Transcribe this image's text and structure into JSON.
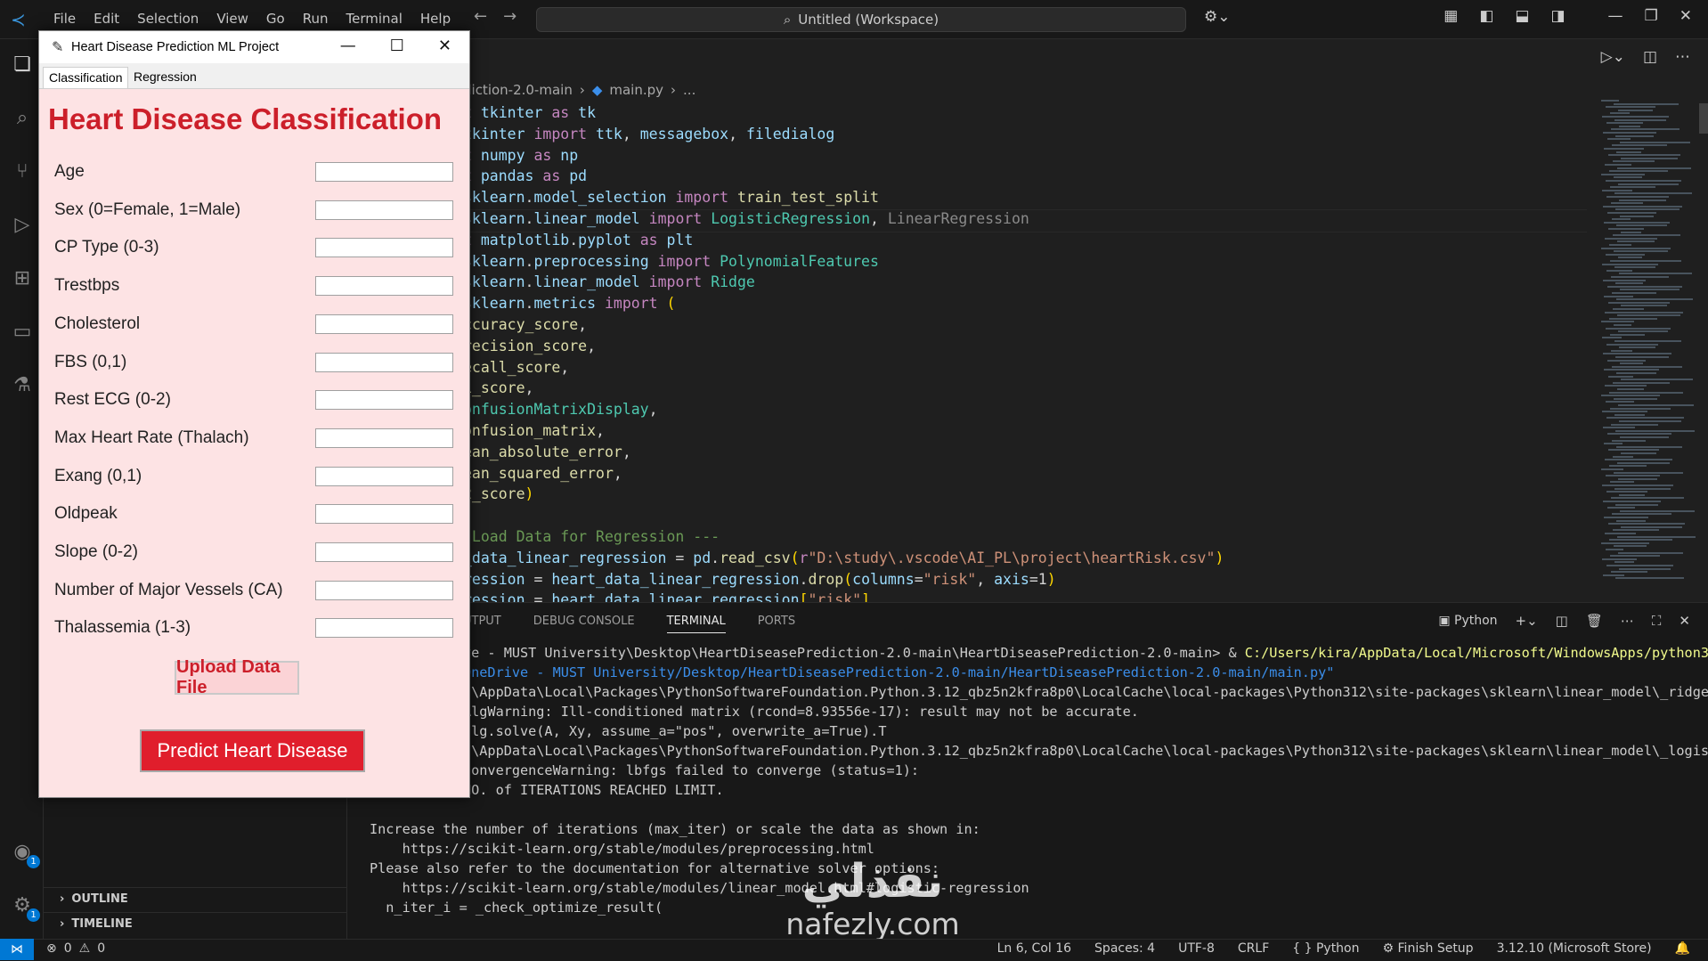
{
  "vscode": {
    "menu": [
      "File",
      "Edit",
      "Selection",
      "View",
      "Go",
      "Run",
      "Terminal",
      "Help"
    ],
    "search_text": "Untitled (Workspace)",
    "breadcrumb": {
      "folder": "diction-2.0-main",
      "file": "main.py",
      "more": "..."
    },
    "code_lines": [
      [
        [
          "kw",
          "t "
        ],
        [
          "id",
          "tkinter"
        ],
        [
          "kw",
          " as "
        ],
        [
          "id",
          "tk"
        ]
      ],
      [
        [
          "id",
          "tkinter"
        ],
        [
          "kw",
          " import "
        ],
        [
          "id",
          "ttk"
        ],
        [
          "pn",
          ", "
        ],
        [
          "id",
          "messagebox"
        ],
        [
          "pn",
          ", "
        ],
        [
          "id",
          "filedialog"
        ]
      ],
      [
        [
          "kw",
          "t "
        ],
        [
          "id",
          "numpy"
        ],
        [
          "kw",
          " as "
        ],
        [
          "id",
          "np"
        ]
      ],
      [
        [
          "kw",
          "t "
        ],
        [
          "id",
          "pandas"
        ],
        [
          "kw",
          " as "
        ],
        [
          "id",
          "pd"
        ]
      ],
      [
        [
          "id",
          "sklearn"
        ],
        [
          "pn",
          "."
        ],
        [
          "id",
          "model_selection"
        ],
        [
          "kw",
          " import "
        ],
        [
          "fn",
          "train_test_split"
        ]
      ],
      [
        [
          "id",
          "sklearn"
        ],
        [
          "pn",
          "."
        ],
        [
          "id",
          "linear_model"
        ],
        [
          "kw",
          " import "
        ],
        [
          "cls",
          "LogisticRegression"
        ],
        [
          "pn",
          ", "
        ],
        [
          "dim",
          "LinearRegression"
        ]
      ],
      [
        [
          "kw",
          "t "
        ],
        [
          "id",
          "matplotlib"
        ],
        [
          "pn",
          "."
        ],
        [
          "id",
          "pyplot"
        ],
        [
          "kw",
          " as "
        ],
        [
          "id",
          "plt"
        ]
      ],
      [
        [
          "id",
          "sklearn"
        ],
        [
          "pn",
          "."
        ],
        [
          "id",
          "preprocessing"
        ],
        [
          "kw",
          " import "
        ],
        [
          "cls",
          "PolynomialFeatures"
        ]
      ],
      [
        [
          "id",
          "sklearn"
        ],
        [
          "pn",
          "."
        ],
        [
          "id",
          "linear_model"
        ],
        [
          "kw",
          " import "
        ],
        [
          "cls",
          "Ridge"
        ]
      ],
      [
        [
          "id",
          "sklearn"
        ],
        [
          "pn",
          "."
        ],
        [
          "id",
          "metrics"
        ],
        [
          "kw",
          " import "
        ],
        [
          "br",
          "("
        ]
      ],
      [
        [
          "fn",
          "ccuracy_score"
        ],
        [
          "pn",
          ","
        ]
      ],
      [
        [
          "fn",
          "recision_score"
        ],
        [
          "pn",
          ","
        ]
      ],
      [
        [
          "fn",
          "ecall_score"
        ],
        [
          "pn",
          ","
        ]
      ],
      [
        [
          "fn",
          "1_score"
        ],
        [
          "pn",
          ","
        ]
      ],
      [
        [
          "cls",
          "onfusionMatrixDisplay"
        ],
        [
          "pn",
          ","
        ]
      ],
      [
        [
          "fn",
          "onfusion_matrix"
        ],
        [
          "pn",
          ","
        ]
      ],
      [
        [
          "fn",
          "ean_absolute_error"
        ],
        [
          "pn",
          ","
        ]
      ],
      [
        [
          "fn",
          "ean_squared_error"
        ],
        [
          "pn",
          ","
        ]
      ],
      [
        [
          "fn",
          "2_score"
        ],
        [
          "br",
          ")"
        ]
      ],
      [
        [
          "pn",
          ""
        ]
      ],
      [
        [
          "cm",
          " Load Data for Regression ---"
        ]
      ],
      [
        [
          "id",
          "_data_linear_regression"
        ],
        [
          "pn",
          " = "
        ],
        [
          "id",
          "pd"
        ],
        [
          "pn",
          "."
        ],
        [
          "fn",
          "read_csv"
        ],
        [
          "br",
          "("
        ],
        [
          "kw",
          "r"
        ],
        [
          "str",
          "\"D:\\study\\.vscode\\AI_PL\\project\\heartRisk.csv\""
        ],
        [
          "br",
          ")"
        ]
      ],
      [
        [
          "id",
          "ression"
        ],
        [
          "pn",
          " = "
        ],
        [
          "id",
          "heart_data_linear_regression"
        ],
        [
          "pn",
          "."
        ],
        [
          "fn",
          "drop"
        ],
        [
          "br",
          "("
        ],
        [
          "id",
          "columns"
        ],
        [
          "pn",
          "="
        ],
        [
          "str",
          "\"risk\""
        ],
        [
          "pn",
          ", "
        ],
        [
          "id",
          "axis"
        ],
        [
          "pn",
          "=1"
        ],
        [
          "br",
          ")"
        ]
      ],
      [
        [
          "id",
          "ression"
        ],
        [
          "pn",
          " = "
        ],
        [
          "id",
          "heart_data_linear_regression"
        ],
        [
          "br",
          "["
        ],
        [
          "str",
          "\"risk\""
        ],
        [
          "br",
          "]"
        ]
      ]
    ],
    "panel_tabs": [
      "UTPUT",
      "DEBUG CONSOLE",
      "TERMINAL",
      "PORTS"
    ],
    "panel_shell": "Python",
    "terminal_lines": [
      [
        [
          "",
          "ve - MUST University\\Desktop\\HeartDiseasePrediction-2.0-main\\HeartDiseasePrediction-2.0-main> & "
        ],
        [
          "yl",
          "C:/Users/kira/AppData/Local/Microsoft/WindowsApps/python3"
        ]
      ],
      [
        [
          "bl",
          "OneDrive - MUST University/Desktop/HeartDiseasePrediction-2.0-main/HeartDiseasePrediction-2.0-main/main.py\""
        ]
      ],
      [
        [
          "",
          "a\\AppData\\Local\\Packages\\PythonSoftwareFoundation.Python.3.12_qbz5n2kfra8p0\\LocalCache\\local-packages\\Python312\\site-packages\\sklearn\\linear_model\\_ridge"
        ]
      ],
      [
        [
          "",
          "AlgWarning: Ill-conditioned matrix (rcond=8.93556e-17): result may not be accurate."
        ]
      ],
      [
        [
          "",
          "alg.solve(A, Xy, assume_a=\"pos\", overwrite_a=True).T"
        ]
      ],
      [
        [
          "",
          "a\\AppData\\Local\\Packages\\PythonSoftwareFoundation.Python.3.12_qbz5n2kfra8p0\\LocalCache\\local-packages\\Python312\\site-packages\\sklearn\\linear_model\\_logis"
        ]
      ],
      [
        [
          "",
          "ConvergenceWarning: lbfgs failed to converge (status=1):"
        ]
      ],
      [
        [
          "",
          "NO. of ITERATIONS REACHED LIMIT."
        ]
      ],
      [
        [
          "",
          ""
        ]
      ],
      [
        [
          "",
          "Increase the number of iterations (max_iter) or scale the data as shown in:"
        ]
      ],
      [
        [
          "",
          "    https://scikit-learn.org/stable/modules/preprocessing.html"
        ]
      ],
      [
        [
          "",
          "Please also refer to the documentation for alternative solver options:"
        ]
      ],
      [
        [
          "",
          "    https://scikit-learn.org/stable/modules/linear_model.html#logistic-regression"
        ]
      ],
      [
        [
          "",
          "  n_iter_i = _check_optimize_result("
        ]
      ]
    ],
    "sidebar_sections": [
      "OUTLINE",
      "TIMELINE"
    ],
    "status": {
      "errors": "0",
      "warnings": "0",
      "position": "Ln 6, Col 16",
      "spaces": "Spaces: 4",
      "encoding": "UTF-8",
      "eol": "CRLF",
      "language": "Python",
      "finish_setup": "Finish Setup",
      "interpreter": "3.12.10 (Microsoft Store)"
    },
    "badges": {
      "accounts": "1",
      "manage": "1"
    }
  },
  "watermark": {
    "arabic": "نفذلي",
    "latin": "nafezly.com"
  },
  "tk": {
    "title": "Heart Disease Prediction ML Project",
    "tabs": [
      "Classification",
      "Regression"
    ],
    "heading": "Heart Disease Classification",
    "fields": [
      {
        "label": "Age",
        "value": ""
      },
      {
        "label": "Sex (0=Female, 1=Male)",
        "value": ""
      },
      {
        "label": "CP Type (0-3)",
        "value": ""
      },
      {
        "label": "Trestbps",
        "value": ""
      },
      {
        "label": "Cholesterol",
        "value": ""
      },
      {
        "label": "FBS (0,1)",
        "value": ""
      },
      {
        "label": "Rest ECG (0-2)",
        "value": ""
      },
      {
        "label": "Max Heart Rate (Thalach)",
        "value": ""
      },
      {
        "label": "Exang (0,1)",
        "value": ""
      },
      {
        "label": "Oldpeak",
        "value": ""
      },
      {
        "label": "Slope (0-2)",
        "value": ""
      },
      {
        "label": "Number of Major Vessels (CA)",
        "value": ""
      },
      {
        "label": "Thalassemia (1-3)",
        "value": ""
      }
    ],
    "upload_label": "Upload Data File",
    "predict_label": "Predict Heart Disease"
  },
  "colors": {
    "accent": "#0078d4",
    "tk_bg": "#fde3e4",
    "tk_red": "#cc1f2a",
    "predict_bg": "#e01e2c"
  }
}
